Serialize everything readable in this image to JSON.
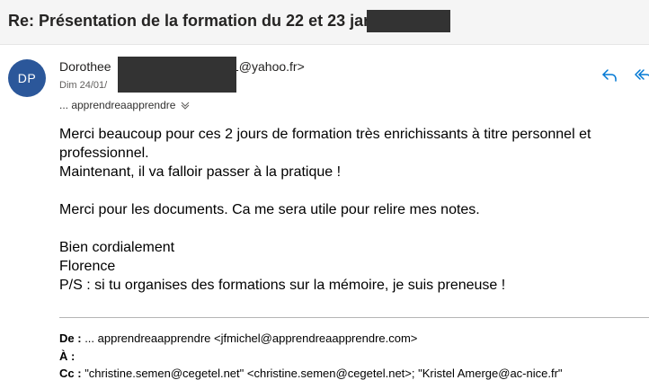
{
  "subject": {
    "title": "Re: Présentation de la formation du 22 et 23 jan"
  },
  "sender": {
    "avatar_initials": "DP",
    "avatar_color": "#2b579a",
    "name_prefix": "Dorothee",
    "email_suffix": "1@yahoo.fr>",
    "date": "Dim 24/01/"
  },
  "recipients": {
    "label": "... apprendreaapprendre"
  },
  "actions": {
    "reply_icon": "reply-icon",
    "reply_all_icon": "reply-all-icon",
    "accent_color": "#0078d4"
  },
  "message": {
    "line1": "Merci beaucoup pour ces 2 jours de formation très enrichissants à titre personnel et professionnel.",
    "line2": "Maintenant, il va falloir passer à la pratique !",
    "line3": "Merci pour les documents. Ca me sera utile pour relire mes notes.",
    "line4": "Bien cordialement",
    "line5": "Florence",
    "line6": "P/S : si tu organises des formations sur la mémoire, je suis preneuse !"
  },
  "forwarded": {
    "from_label": "De :",
    "from_value": "... apprendreaapprendre <jfmichel@apprendreaapprendre.com>",
    "to_label": "À :",
    "cc_label": "Cc :",
    "cc_value": "\"christine.semen@cegetel.net\" <christine.semen@cegetel.net>; \"Kristel Amerge@ac-nice.fr\""
  }
}
